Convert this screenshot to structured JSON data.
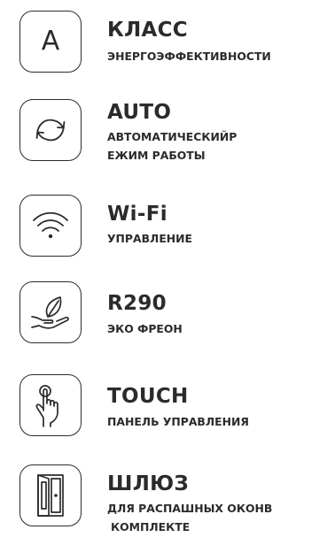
{
  "features": [
    {
      "icon": "letter-a-icon",
      "icon_text": "A",
      "title": "КЛАСС",
      "lines": [
        "ЭНЕРГОЭФФЕКТИВНОСТИ"
      ]
    },
    {
      "icon": "refresh-arrows-icon",
      "title": "AUTO",
      "lines": [
        "АВТОМАТИЧЕСКИЙР",
        "ЕЖИМ РАБОТЫ"
      ]
    },
    {
      "icon": "wifi-icon",
      "title": "Wi-Fi",
      "lines": [
        "УПРАВЛЕНИЕ"
      ]
    },
    {
      "icon": "leaf-hand-icon",
      "title": "R290",
      "lines": [
        "ЭКО ФРЕОН"
      ]
    },
    {
      "icon": "touch-hand-icon",
      "title": "TOUCH",
      "lines": [
        "ПАНЕЛЬ УПРАВЛЕНИЯ"
      ]
    },
    {
      "icon": "window-lock-icon",
      "title": "ШЛЮЗ",
      "lines": [
        "ДЛЯ РАСПАШНЫХ ОКОНВ",
        "КОМПЛЕКТЕ"
      ]
    }
  ],
  "colors": {
    "text": "#2b2b2b",
    "background": "#ffffff"
  }
}
